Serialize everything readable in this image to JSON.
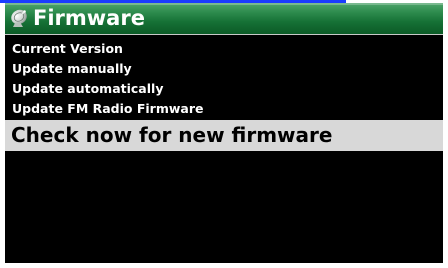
{
  "title": {
    "text": "Firmware",
    "icon": "satellite-dish-icon"
  },
  "menu": {
    "items": [
      {
        "label": "Current Version",
        "selected": false
      },
      {
        "label": "Update manually",
        "selected": false
      },
      {
        "label": "Update automatically",
        "selected": false
      },
      {
        "label": "Update FM Radio Firmware",
        "selected": false
      },
      {
        "label": "Check now for new firmware",
        "selected": true
      }
    ]
  },
  "colors": {
    "title_bar": "#167236",
    "background": "#000000",
    "highlight": "#d8d8d8",
    "text": "#ffffff",
    "selected_text": "#000000"
  }
}
